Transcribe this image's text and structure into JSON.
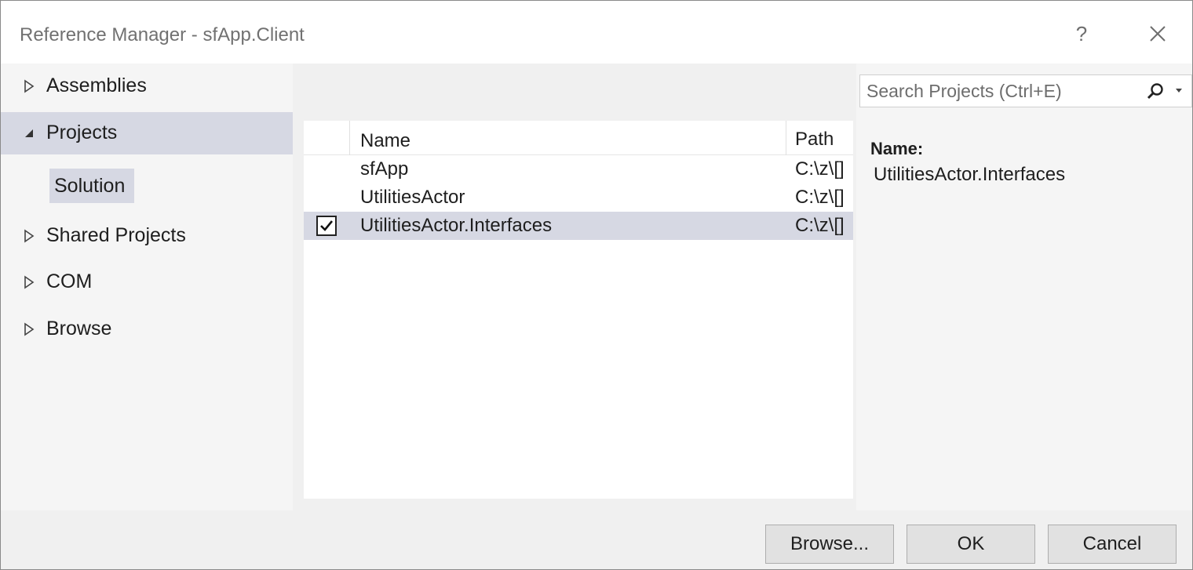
{
  "window": {
    "title": "Reference Manager - sfApp.Client",
    "help_label": "?"
  },
  "nav": {
    "items": [
      {
        "label": "Assemblies",
        "expanded": false
      },
      {
        "label": "Projects",
        "expanded": true
      },
      {
        "label": "Shared Projects",
        "expanded": false
      },
      {
        "label": "COM",
        "expanded": false
      },
      {
        "label": "Browse",
        "expanded": false
      }
    ],
    "subitem": "Solution"
  },
  "list": {
    "columns": [
      "Name",
      "Path"
    ],
    "rows": [
      {
        "name": "sfApp",
        "path": "C:\\z\\[]",
        "checked": false
      },
      {
        "name": "UtilitiesActor",
        "path": "C:\\z\\[]",
        "checked": false
      },
      {
        "name": "UtilitiesActor.Interfaces",
        "path": "C:\\z\\[]",
        "checked": true
      }
    ]
  },
  "search": {
    "placeholder": "Search Projects (Ctrl+E)"
  },
  "details": {
    "label": "Name:",
    "value": "UtilitiesActor.Interfaces"
  },
  "buttons": {
    "browse": "Browse...",
    "ok": "OK",
    "cancel": "Cancel"
  },
  "colors": {
    "selection": "#d6d8e3",
    "panel": "#f5f5f5",
    "list_background": "#ffffff"
  },
  "icons": {
    "help": "help-icon",
    "close": "close-icon",
    "collapsed": "triangle-right-icon",
    "expanded": "triangle-down-icon",
    "search": "magnifier-icon",
    "dropdown": "chevron-down-icon",
    "check": "checkmark-icon"
  }
}
